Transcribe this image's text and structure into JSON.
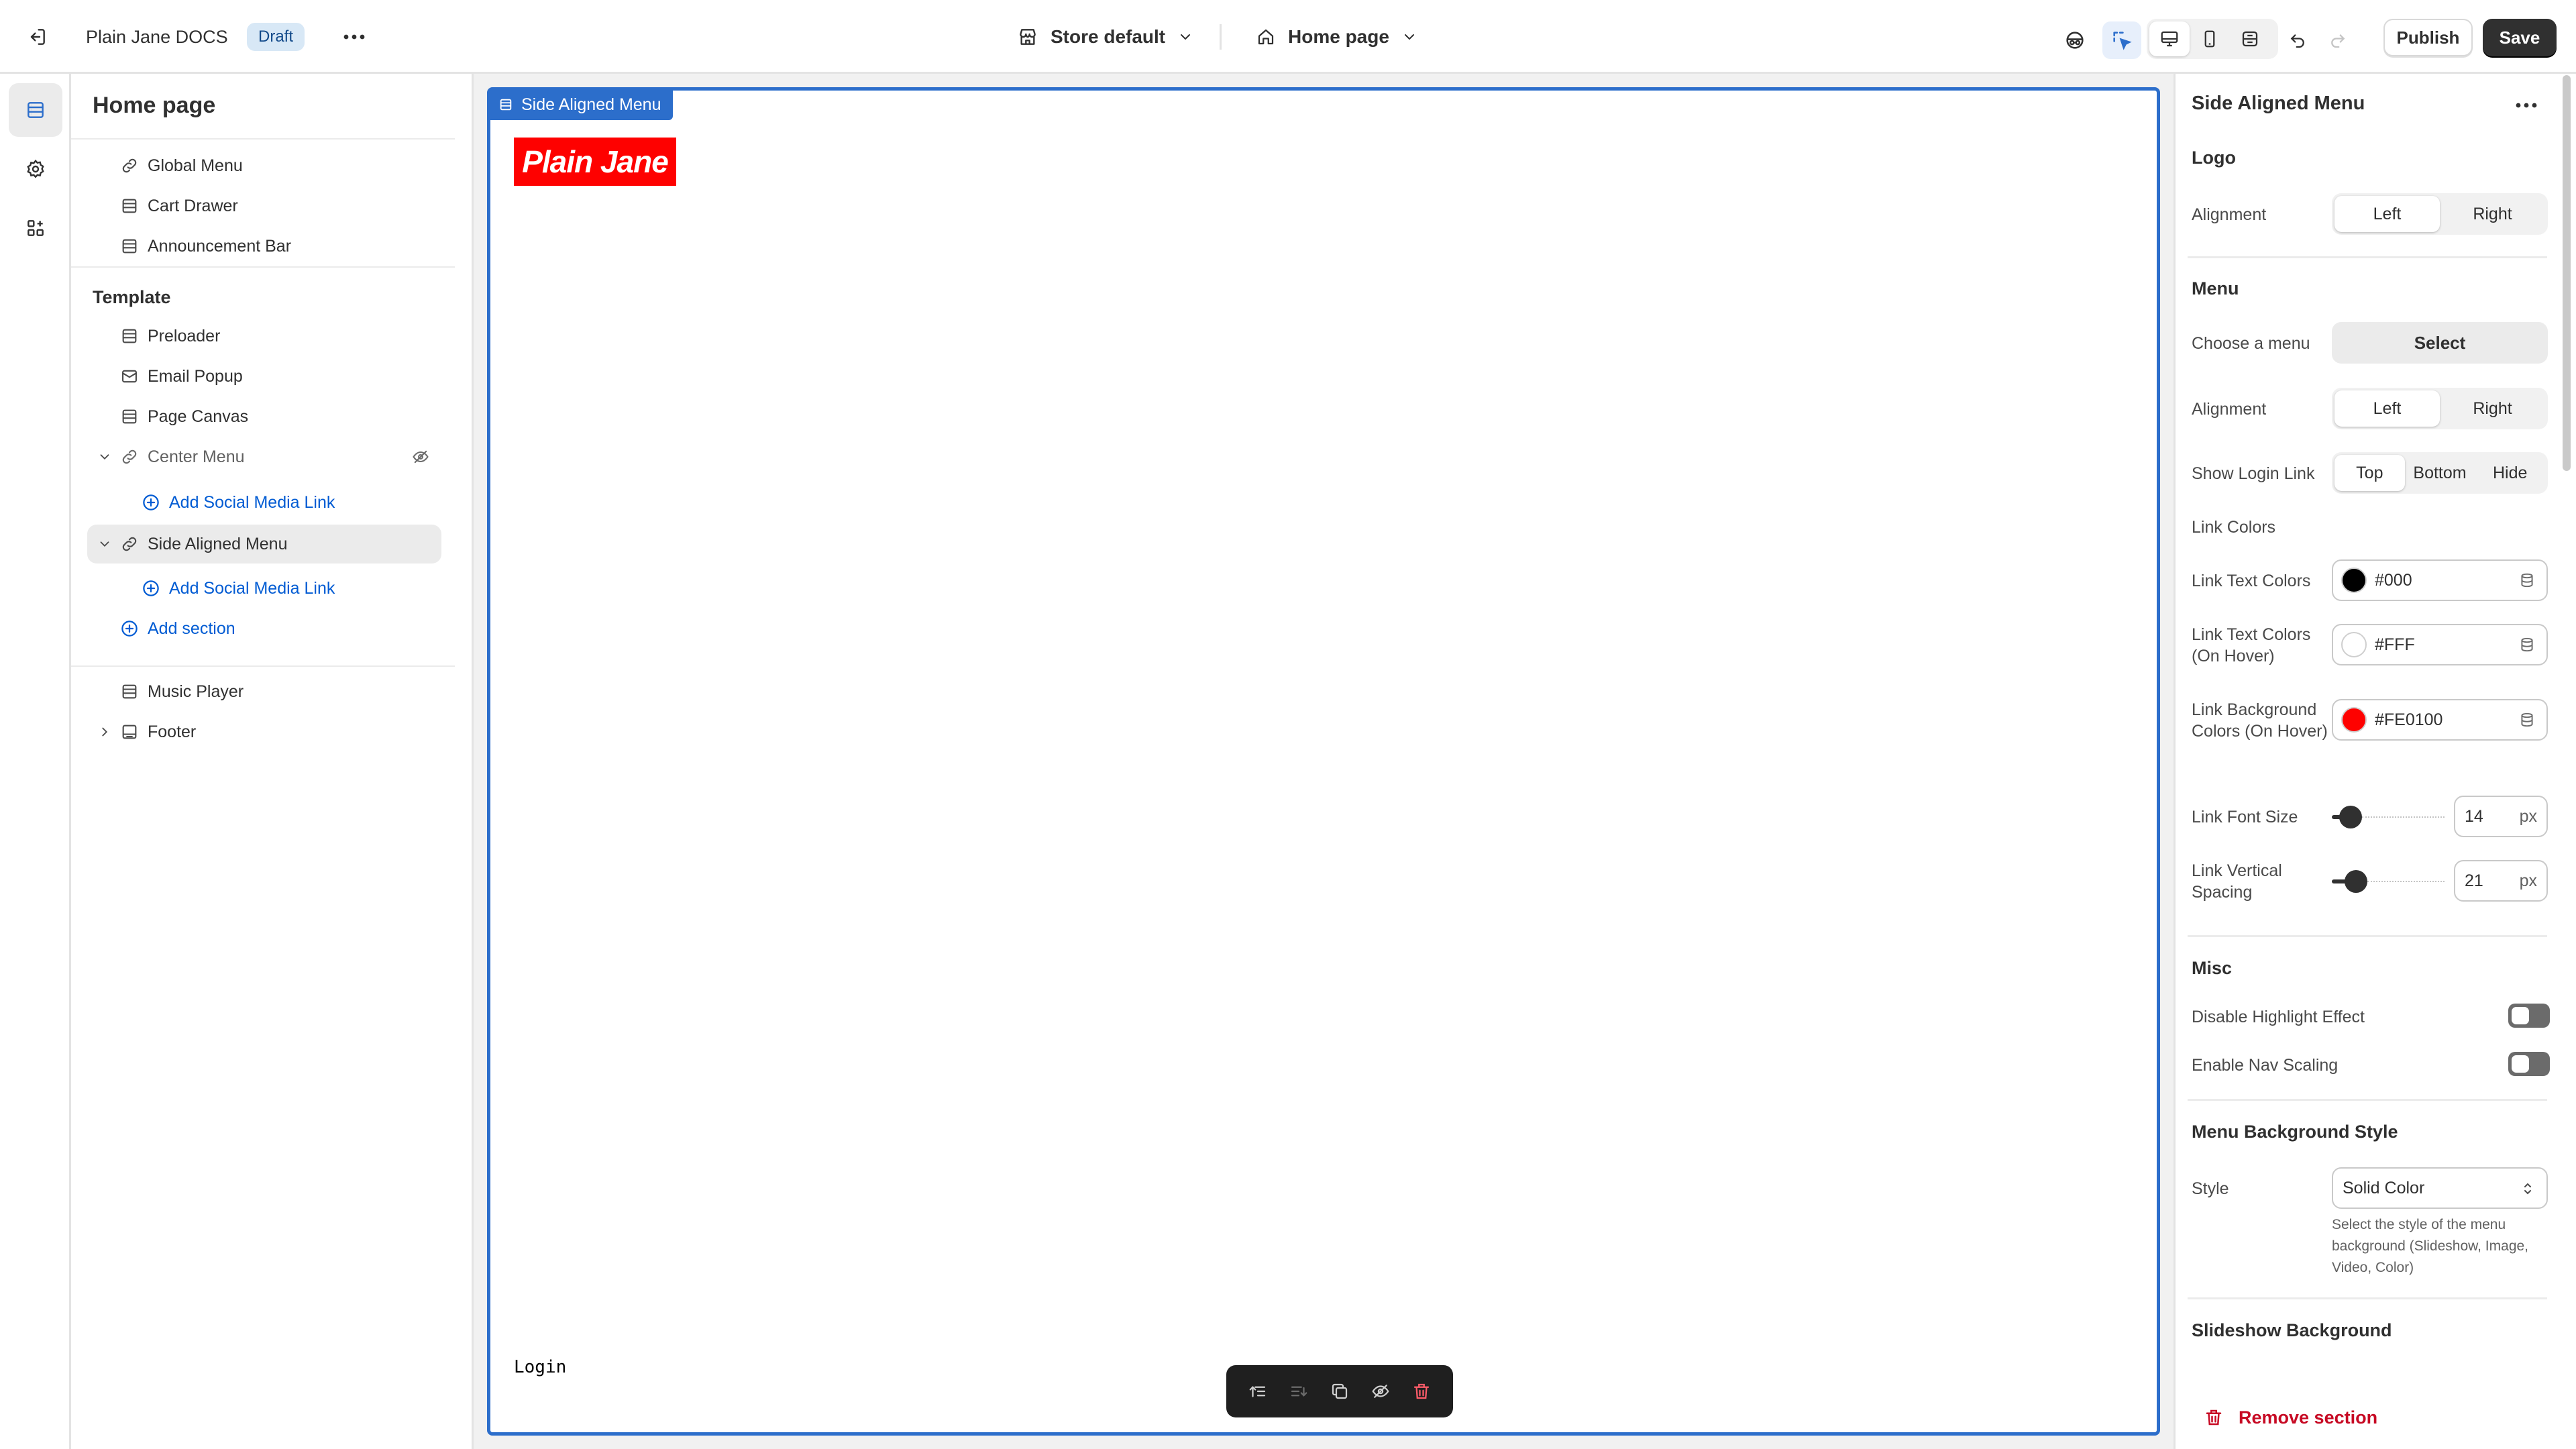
{
  "topbar": {
    "store_name": "Plain Jane DOCS",
    "status_badge": "Draft",
    "store_selector": "Store default",
    "page_selector": "Home page",
    "publish_label": "Publish",
    "save_label": "Save"
  },
  "sidebar": {
    "title": "Home page",
    "header_items": [
      {
        "label": "Global Menu",
        "icon": "link-icon"
      },
      {
        "label": "Cart Drawer",
        "icon": "section-icon"
      },
      {
        "label": "Announcement Bar",
        "icon": "section-icon"
      }
    ],
    "template_heading": "Template",
    "template_items": [
      {
        "label": "Preloader"
      },
      {
        "label": "Email Popup"
      },
      {
        "label": "Page Canvas"
      },
      {
        "label": "Center Menu"
      },
      {
        "label": "Add Social Media Link"
      },
      {
        "label": "Side Aligned Menu"
      },
      {
        "label": "Add Social Media Link"
      },
      {
        "label": "Add section"
      }
    ],
    "footer_items": [
      {
        "label": "Music Player"
      },
      {
        "label": "Footer"
      }
    ]
  },
  "canvas": {
    "section_tag": "Side Aligned Menu",
    "logo_text": "Plain Jane",
    "login_text": "Login"
  },
  "panel": {
    "title": "Side Aligned Menu",
    "logo_section": "Logo",
    "logo_alignment_label": "Alignment",
    "logo_alignment_options": [
      "Left",
      "Right"
    ],
    "menu_section": "Menu",
    "choose_menu_label": "Choose a menu",
    "choose_menu_button": "Select",
    "menu_alignment_label": "Alignment",
    "menu_alignment_options": [
      "Left",
      "Right"
    ],
    "show_login_label": "Show Login Link",
    "show_login_options": [
      "Top",
      "Bottom",
      "Hide"
    ],
    "link_colors_label": "Link Colors",
    "link_text_colors_label": "Link Text Colors",
    "link_text_colors_value": "#000",
    "link_hover_label": "Link Text Colors (On Hover)",
    "link_hover_value": "#FFF",
    "link_bg_label": "Link Background Colors (On Hover)",
    "link_bg_value": "#FE0100",
    "font_size_label": "Link Font Size",
    "font_size_value": "14",
    "vertical_spacing_label": "Link Vertical Spacing",
    "vertical_spacing_value": "21",
    "unit": "px",
    "misc_section": "Misc",
    "disable_highlight_label": "Disable Highlight Effect",
    "enable_nav_scaling_label": "Enable Nav Scaling",
    "bg_style_section": "Menu Background Style",
    "style_label": "Style",
    "style_value": "Solid Color",
    "style_help": "Select the style of the menu background (Slideshow, Image, Video, Color)",
    "slideshow_section": "Slideshow Background",
    "remove_section_label": "Remove section"
  },
  "colors": {
    "accent": "#2c6ecb",
    "link_text": "#000000",
    "link_hover_text": "#ffffff",
    "link_bg_hover": "#fe0100",
    "logo_bg": "#fe0100",
    "danger": "#c70a24"
  },
  "controls": {
    "font_size_slider_fraction": 0.08,
    "vertical_spacing_slider_fraction": 0.14
  }
}
